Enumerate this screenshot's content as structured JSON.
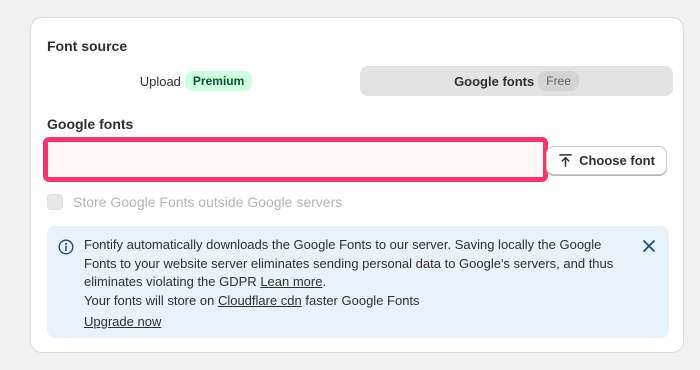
{
  "font_source": {
    "title": "Font source",
    "upload_label": "Upload",
    "upload_badge": "Premium",
    "google_label": "Google fonts",
    "google_badge": "Free",
    "selected": "google"
  },
  "google_fonts": {
    "title": "Google fonts",
    "input_value": "",
    "input_placeholder": "",
    "choose_button": "Choose font"
  },
  "store_option": {
    "label": "Store Google Fonts outside Google servers",
    "checked": false,
    "disabled": true
  },
  "banner": {
    "line1_text": "Fontify automatically downloads the Google Fonts to our server. Saving locally the Google Fonts to your website server eliminates sending personal data to Google's servers, and thus eliminates violating the GDPR ",
    "learn_more": "Lean more",
    "line1_end": ".",
    "line2_prefix": "Your fonts will store on ",
    "cloudflare_link": "Cloudflare cdn",
    "line2_suffix": " faster Google Fonts",
    "upgrade_link": "Upgrade now"
  },
  "icons": {
    "info": "info-icon",
    "close": "close-icon",
    "upload": "upload-arrow-icon"
  },
  "colors": {
    "premium_badge_bg": "#cdfee1",
    "premium_badge_text": "#0c5132",
    "highlight_outline": "#f8356a",
    "banner_bg": "#e8f2fb",
    "info_accent": "#1a4d7a"
  }
}
